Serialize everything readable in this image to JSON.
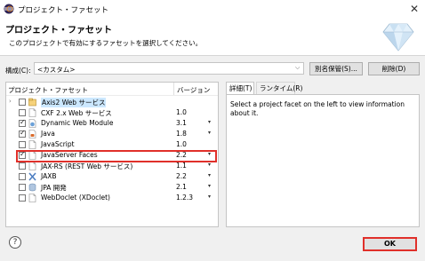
{
  "window": {
    "title": "プロジェクト・ファセット",
    "close_glyph": "✕"
  },
  "header": {
    "title": "プロジェクト・ファセット",
    "description": "このプロジェクトで有効にするファセットを選択してください。"
  },
  "config": {
    "label": "構成(C):",
    "value": "<カスタム>",
    "save_as_label": "別名保管(S)...",
    "delete_label": "削除(D)"
  },
  "facets": {
    "col_name": "プロジェクト・ファセット",
    "col_version": "バージョン",
    "items": [
      {
        "name": "Axis2 Web サービス",
        "version": "",
        "checked": false,
        "expandable": true,
        "has_dropdown": false,
        "icon": "folder-icon"
      },
      {
        "name": "CXF 2.x Web サービス",
        "version": "1.0",
        "checked": false,
        "expandable": false,
        "has_dropdown": false,
        "icon": "page-icon"
      },
      {
        "name": "Dynamic Web Module",
        "version": "3.1",
        "checked": true,
        "expandable": false,
        "has_dropdown": true,
        "icon": "web-module-icon"
      },
      {
        "name": "Java",
        "version": "1.8",
        "checked": true,
        "expandable": false,
        "has_dropdown": true,
        "icon": "java-icon"
      },
      {
        "name": "JavaScript",
        "version": "1.0",
        "checked": false,
        "expandable": false,
        "has_dropdown": false,
        "icon": "page-icon"
      },
      {
        "name": "JavaServer Faces",
        "version": "2.2",
        "checked": true,
        "expandable": false,
        "has_dropdown": true,
        "icon": "page-icon"
      },
      {
        "name": "JAX-RS (REST Web サービス)",
        "version": "1.1",
        "checked": false,
        "expandable": false,
        "has_dropdown": true,
        "icon": "page-icon"
      },
      {
        "name": "JAXB",
        "version": "2.2",
        "checked": false,
        "expandable": false,
        "has_dropdown": true,
        "icon": "jaxb-icon"
      },
      {
        "name": "JPA 開発",
        "version": "2.1",
        "checked": false,
        "expandable": false,
        "has_dropdown": true,
        "icon": "jpa-icon"
      },
      {
        "name": "WebDoclet (XDoclet)",
        "version": "1.2.3",
        "checked": false,
        "expandable": false,
        "has_dropdown": true,
        "icon": "page-icon"
      }
    ]
  },
  "detail": {
    "tab_detail": "詳細(T)",
    "tab_runtime": "ランタイム(R)",
    "text": "Select a project facet on the left to view information about it."
  },
  "footer": {
    "help_glyph": "?",
    "ok_label": "OK"
  },
  "colors": {
    "highlight_red": "#e0302a",
    "selection_blue": "#cce8ff"
  }
}
